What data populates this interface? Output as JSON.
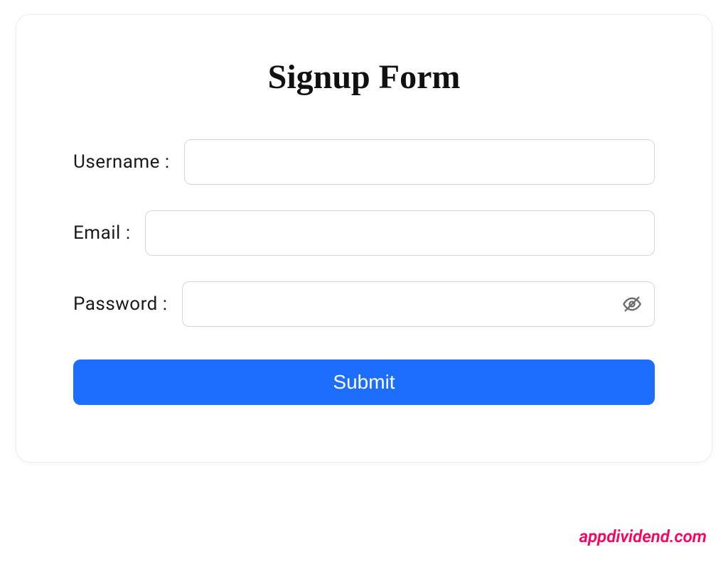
{
  "form": {
    "title": "Signup Form",
    "username_label": "Username :",
    "email_label": "Email :",
    "password_label": "Password :",
    "submit_label": "Submit",
    "username_value": "",
    "email_value": "",
    "password_value": ""
  },
  "watermark": "appdividend.com",
  "colors": {
    "primary": "#1d6efd",
    "watermark": "#ff0060"
  }
}
